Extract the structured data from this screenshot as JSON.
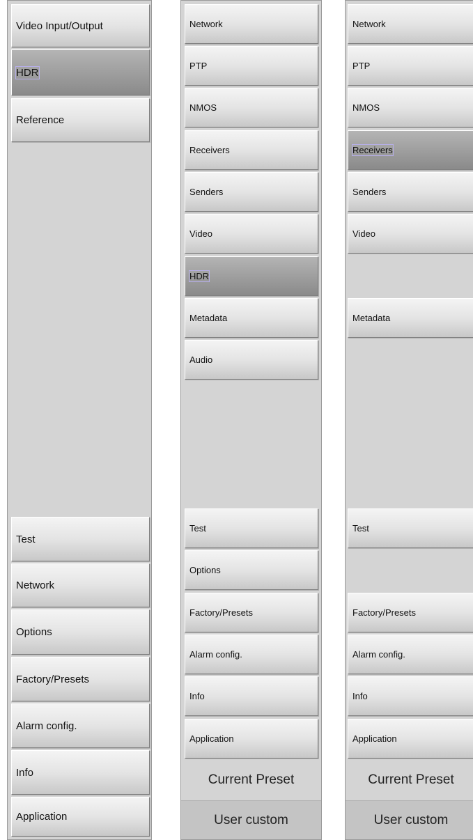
{
  "panel1": {
    "items": [
      "Video Input/Output",
      "HDR",
      "Reference",
      "Test",
      "Network",
      "Options",
      "Factory/Presets",
      "Alarm config.",
      "Info",
      "Application"
    ],
    "selected": "HDR"
  },
  "panel2": {
    "items": [
      "Network",
      "PTP",
      "NMOS",
      "Receivers",
      "Senders",
      "Video",
      "HDR",
      "Metadata",
      "Audio",
      "Test",
      "Options",
      "Factory/Presets",
      "Alarm config.",
      "Info",
      "Application"
    ],
    "selected": "HDR",
    "preset_title": "Current Preset",
    "preset_value": "User custom"
  },
  "panel3": {
    "items": [
      "Network",
      "PTP",
      "NMOS",
      "Receivers",
      "Senders",
      "Video",
      "Metadata",
      "Test",
      "Factory/Presets",
      "Alarm config.",
      "Info",
      "Application"
    ],
    "selected": "Receivers",
    "preset_title": "Current Preset",
    "preset_value": "User custom"
  }
}
